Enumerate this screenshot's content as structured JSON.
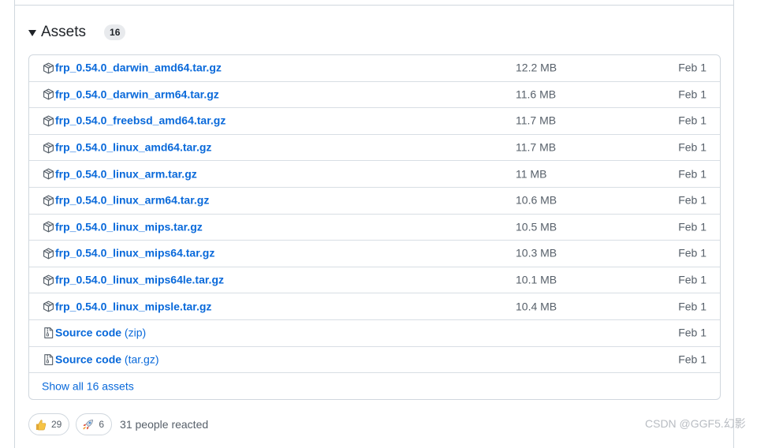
{
  "assets": {
    "title": "Assets",
    "count": "16",
    "rows": [
      {
        "name": "frp_0.54.0_darwin_amd64.tar.gz",
        "size": "12.2 MB",
        "date": "Feb 1",
        "icon": "package-icon"
      },
      {
        "name": "frp_0.54.0_darwin_arm64.tar.gz",
        "size": "11.6 MB",
        "date": "Feb 1",
        "icon": "package-icon"
      },
      {
        "name": "frp_0.54.0_freebsd_amd64.tar.gz",
        "size": "11.7 MB",
        "date": "Feb 1",
        "icon": "package-icon"
      },
      {
        "name": "frp_0.54.0_linux_amd64.tar.gz",
        "size": "11.7 MB",
        "date": "Feb 1",
        "icon": "package-icon"
      },
      {
        "name": "frp_0.54.0_linux_arm.tar.gz",
        "size": "11 MB",
        "date": "Feb 1",
        "icon": "package-icon"
      },
      {
        "name": "frp_0.54.0_linux_arm64.tar.gz",
        "size": "10.6 MB",
        "date": "Feb 1",
        "icon": "package-icon"
      },
      {
        "name": "frp_0.54.0_linux_mips.tar.gz",
        "size": "10.5 MB",
        "date": "Feb 1",
        "icon": "package-icon"
      },
      {
        "name": "frp_0.54.0_linux_mips64.tar.gz",
        "size": "10.3 MB",
        "date": "Feb 1",
        "icon": "package-icon"
      },
      {
        "name": "frp_0.54.0_linux_mips64le.tar.gz",
        "size": "10.1 MB",
        "date": "Feb 1",
        "icon": "package-icon"
      },
      {
        "name": "frp_0.54.0_linux_mipsle.tar.gz",
        "size": "10.4 MB",
        "date": "Feb 1",
        "icon": "package-icon"
      }
    ],
    "source_rows": [
      {
        "name": "Source code",
        "suffix": "(zip)",
        "date": "Feb 1",
        "icon": "file-zip-icon"
      },
      {
        "name": "Source code",
        "suffix": "(tar.gz)",
        "date": "Feb 1",
        "icon": "file-zip-icon"
      }
    ],
    "show_all": "Show all 16 assets"
  },
  "reactions": {
    "items": [
      {
        "icon": "thumbs-up-icon",
        "count": "29"
      },
      {
        "icon": "rocket-icon",
        "count": "6"
      }
    ],
    "summary": "31 people reacted"
  },
  "watermark": "CSDN @GGF5.幻影",
  "colors": {
    "link": "#0969da",
    "muted": "#57606a",
    "border": "#d0d7de"
  }
}
